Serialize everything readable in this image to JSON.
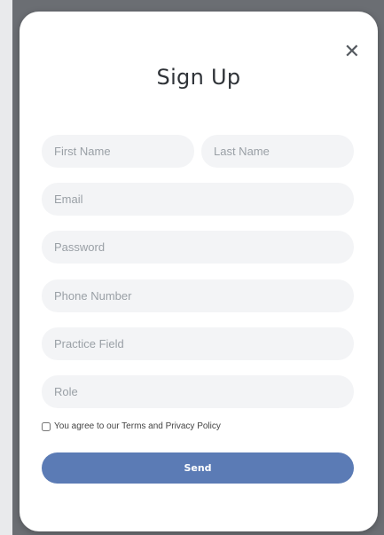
{
  "modal": {
    "title": "Sign Up",
    "close_glyph": "✕"
  },
  "form": {
    "first_name": {
      "placeholder": "First Name",
      "value": ""
    },
    "last_name": {
      "placeholder": "Last Name",
      "value": ""
    },
    "email": {
      "placeholder": "Email",
      "value": ""
    },
    "password": {
      "placeholder": "Password",
      "value": ""
    },
    "phone": {
      "placeholder": "Phone Number",
      "value": ""
    },
    "practice": {
      "placeholder": "Practice Field",
      "value": ""
    },
    "role": {
      "placeholder": "Role",
      "value": ""
    },
    "terms_label": "You agree to our Terms and Privacy Policy",
    "terms_checked": false,
    "send_label": "Send"
  },
  "colors": {
    "backdrop": "#6b6e73",
    "field_bg": "#f3f4f6",
    "button_bg": "#5b7bb5",
    "title_text": "#2f3338"
  },
  "icons": {
    "close": "close-icon"
  }
}
